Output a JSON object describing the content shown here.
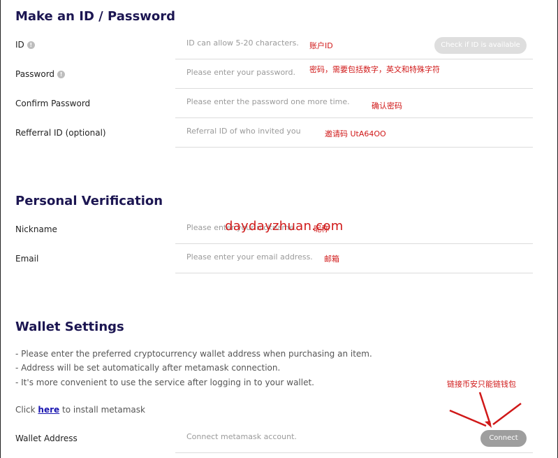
{
  "sections": {
    "account": "Make an ID / Password",
    "personal": "Personal Verification",
    "wallet": "Wallet Settings"
  },
  "account": {
    "id": {
      "label": "ID",
      "placeholder": "ID can allow 5-20 characters.",
      "note": "账户ID",
      "check_button": "Check if ID is available"
    },
    "password": {
      "label": "Password",
      "placeholder": "Please enter your password.",
      "note": "密码，需要包括数字，英文和特殊字符"
    },
    "confirm": {
      "label": "Confirm Password",
      "placeholder": "Please enter the password one more time.",
      "note": "确认密码"
    },
    "referral": {
      "label": "Refferral ID (optional)",
      "placeholder": "Referral ID of who invited you",
      "note": "邀请码 UtA64OO"
    }
  },
  "personal": {
    "nickname": {
      "label": "Nickname",
      "placeholder": "Please enter your nickname.",
      "note": "昵称"
    },
    "email": {
      "label": "Email",
      "placeholder": "Please enter your email address.",
      "note": "邮箱"
    },
    "watermark": "daydayzhuan.com"
  },
  "wallet": {
    "info": [
      "- Please enter the preferred cryptocurrency wallet address when purchasing an item.",
      "- Address will be set automatically after metamask connection.",
      "- It's more convenient to use the service after logging in to your wallet."
    ],
    "install_prefix": "Click ",
    "install_link": "here",
    "install_suffix": " to install metamask",
    "address": {
      "label": "Wallet Address",
      "placeholder": "Connect metamask account.",
      "note": "链接币安只能链钱包",
      "connect_button": "Connect"
    }
  },
  "colors": {
    "title": "#1c1652",
    "note": "#d01818",
    "link": "#1b17b0",
    "connect_button": "#9e9e9e",
    "check_button": "#dedede"
  }
}
